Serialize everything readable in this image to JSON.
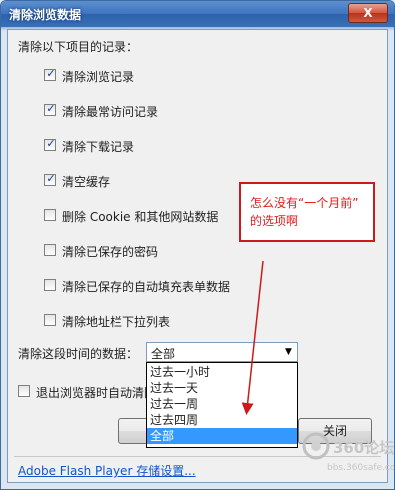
{
  "window": {
    "title": "清除浏览数据",
    "close_label": "X"
  },
  "section_label": "清除以下项目的记录：",
  "options": [
    {
      "label": "清除浏览记录",
      "checked": true
    },
    {
      "label": "清除最常访问记录",
      "checked": true
    },
    {
      "label": "清除下载记录",
      "checked": true
    },
    {
      "label": "清空缓存",
      "checked": true
    },
    {
      "label": "删除 Cookie 和其他网站数据",
      "checked": false
    },
    {
      "label": "清除已保存的密码",
      "checked": false
    },
    {
      "label": "清除已保存的自动填充表单数据",
      "checked": false
    },
    {
      "label": "清除地址栏下拉列表",
      "checked": false
    }
  ],
  "time_range": {
    "label": "清除这段时间的数据：",
    "selected": "全部",
    "options": [
      "过去一小时",
      "过去一天",
      "过去一周",
      "过去四周",
      "全部"
    ]
  },
  "exit_clear": {
    "label": "退出浏览器时自动清除",
    "checked": false
  },
  "buttons": {
    "close_label": "关闭"
  },
  "footer_link": "Adobe Flash Player 存储设置...",
  "annotation": {
    "line1": "怎么没有“一个月前”",
    "line2": "的选项啊"
  },
  "watermark": {
    "name": "360论坛",
    "url": "bbs.360safe.com"
  },
  "colors": {
    "title_bar": "#3a70b8",
    "selected_option": "#3399ff",
    "annotation": "#cc1a1a"
  }
}
